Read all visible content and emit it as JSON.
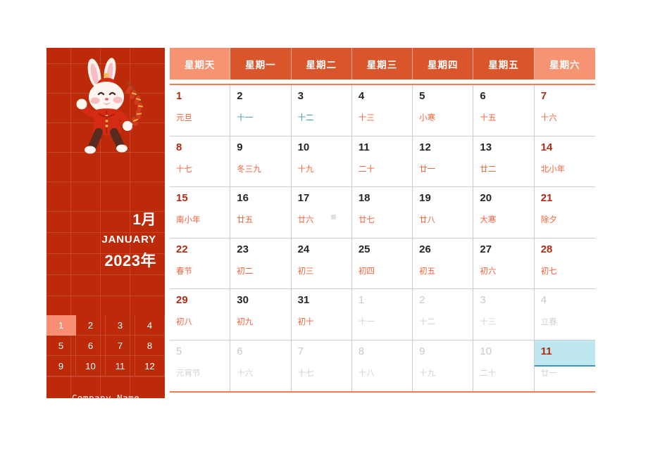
{
  "left_panel": {
    "illustration": "rabbit-lunar-new-year-illustration",
    "month_cn": "1月",
    "month_en": "JANUARY",
    "year_cn": "2023年",
    "months": [
      "1",
      "2",
      "3",
      "4",
      "5",
      "6",
      "7",
      "8",
      "9",
      "10",
      "11",
      "12"
    ],
    "selected_month": "1",
    "company_name": "Company  Name",
    "colors": {
      "background": "#BC2A09",
      "selected_month_bg": "#FA8E72",
      "text": "#FFFFFF"
    }
  },
  "calendar": {
    "weekday_headers": [
      {
        "label": "星期天",
        "type": "weekend"
      },
      {
        "label": "星期一",
        "type": "weekday"
      },
      {
        "label": "星期二",
        "type": "weekday"
      },
      {
        "label": "星期三",
        "type": "weekday"
      },
      {
        "label": "星期四",
        "type": "weekday"
      },
      {
        "label": "星期五",
        "type": "weekday"
      },
      {
        "label": "星期六",
        "type": "weekend"
      }
    ],
    "colors": {
      "header_weekday_bg": "#D9552C",
      "header_weekend_bg": "#F59372",
      "rule": "#F47A54",
      "lunar": "#F4623A",
      "weekend_date": "#AF2B13",
      "weekday_date": "#262626",
      "out_of_month": "#C9C9C9",
      "selected_bg": "#BEE7F1",
      "selected_border": "#3D93B0",
      "grid": "#CCCCCC"
    },
    "weeks": [
      [
        {
          "day": "1",
          "lunar": "元旦",
          "kind": "weekend"
        },
        {
          "day": "2",
          "lunar": "十一",
          "kind": "weekday",
          "lunar_color": "teal"
        },
        {
          "day": "3",
          "lunar": "十二",
          "kind": "weekday",
          "lunar_color": "teal"
        },
        {
          "day": "4",
          "lunar": "十三",
          "kind": "weekday"
        },
        {
          "day": "5",
          "lunar": "小寒",
          "kind": "weekday"
        },
        {
          "day": "6",
          "lunar": "十五",
          "kind": "weekday"
        },
        {
          "day": "7",
          "lunar": "十六",
          "kind": "weekend"
        }
      ],
      [
        {
          "day": "8",
          "lunar": "十七",
          "kind": "weekend"
        },
        {
          "day": "9",
          "lunar": "冬三九",
          "kind": "weekday"
        },
        {
          "day": "10",
          "lunar": "十九",
          "kind": "weekday"
        },
        {
          "day": "11",
          "lunar": "二十",
          "kind": "weekday"
        },
        {
          "day": "12",
          "lunar": "廿一",
          "kind": "weekday"
        },
        {
          "day": "13",
          "lunar": "廿二",
          "kind": "weekday"
        },
        {
          "day": "14",
          "lunar": "北小年",
          "kind": "weekend"
        }
      ],
      [
        {
          "day": "15",
          "lunar": "南小年",
          "kind": "weekend"
        },
        {
          "day": "16",
          "lunar": "廿五",
          "kind": "weekday"
        },
        {
          "day": "17",
          "lunar": "廿六",
          "kind": "weekday",
          "artifact": true
        },
        {
          "day": "18",
          "lunar": "廿七",
          "kind": "weekday"
        },
        {
          "day": "19",
          "lunar": "廿八",
          "kind": "weekday"
        },
        {
          "day": "20",
          "lunar": "大寒",
          "kind": "weekday"
        },
        {
          "day": "21",
          "lunar": "除夕",
          "kind": "weekend"
        }
      ],
      [
        {
          "day": "22",
          "lunar": "春节",
          "kind": "weekend"
        },
        {
          "day": "23",
          "lunar": "初二",
          "kind": "weekday"
        },
        {
          "day": "24",
          "lunar": "初三",
          "kind": "weekday"
        },
        {
          "day": "25",
          "lunar": "初四",
          "kind": "weekday"
        },
        {
          "day": "26",
          "lunar": "初五",
          "kind": "weekday"
        },
        {
          "day": "27",
          "lunar": "初六",
          "kind": "weekday"
        },
        {
          "day": "28",
          "lunar": "初七",
          "kind": "weekend"
        }
      ],
      [
        {
          "day": "29",
          "lunar": "初八",
          "kind": "weekend"
        },
        {
          "day": "30",
          "lunar": "初九",
          "kind": "weekday"
        },
        {
          "day": "31",
          "lunar": "初十",
          "kind": "weekday"
        },
        {
          "day": "1",
          "lunar": "十一",
          "kind": "out"
        },
        {
          "day": "2",
          "lunar": "十二",
          "kind": "out"
        },
        {
          "day": "3",
          "lunar": "十三",
          "kind": "out"
        },
        {
          "day": "4",
          "lunar": "立春",
          "kind": "out"
        }
      ],
      [
        {
          "day": "5",
          "lunar": "元宵节",
          "kind": "out"
        },
        {
          "day": "6",
          "lunar": "十六",
          "kind": "out"
        },
        {
          "day": "7",
          "lunar": "十七",
          "kind": "out"
        },
        {
          "day": "8",
          "lunar": "十八",
          "kind": "out"
        },
        {
          "day": "9",
          "lunar": "十九",
          "kind": "out"
        },
        {
          "day": "10",
          "lunar": "二十",
          "kind": "out"
        },
        {
          "day": "11",
          "lunar": "廿一",
          "kind": "out",
          "selected": true
        }
      ]
    ]
  }
}
